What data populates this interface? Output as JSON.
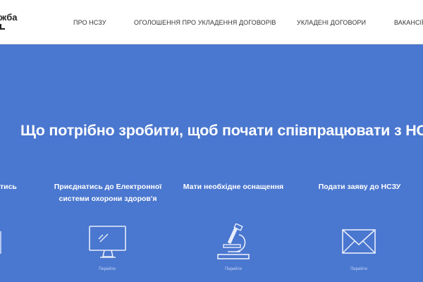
{
  "header": {
    "logo_text": "жба",
    "nav": [
      "ПРО НСЗУ",
      "ОГОЛОШЕННЯ ПРО УКЛАДЕННЯ ДОГОВОРІВ",
      "УКЛАДЕНІ ДОГОВОРИ",
      "ВАКАНСІЇ"
    ]
  },
  "hero": {
    "title": "Що потрібно зробити, щоб почати співпрацювати з НС",
    "steps": [
      {
        "label": "тись",
        "icon": "partial-icon"
      },
      {
        "label": "Приєднатись до Електронної системи охорони здоров'я",
        "icon": "monitor-icon",
        "link": "Перейти"
      },
      {
        "label": "Мати необхідне оснащення",
        "icon": "microscope-icon",
        "link": "Перейти"
      },
      {
        "label": "Подати заяву до НСЗУ",
        "icon": "envelope-icon",
        "link": "Перейти"
      }
    ]
  },
  "colors": {
    "hero_background": "#4a77cf",
    "header_background": "#ffffff",
    "text_light": "#ffffff"
  }
}
